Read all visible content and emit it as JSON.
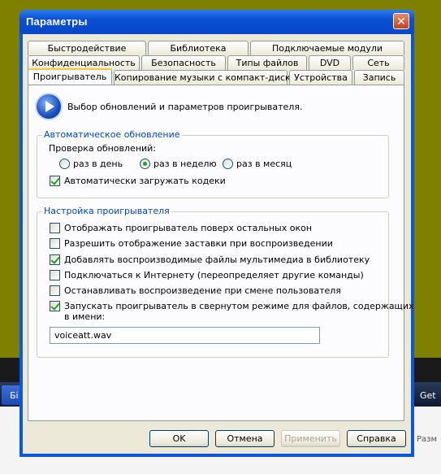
{
  "window": {
    "title": "Параметры"
  },
  "tabs": {
    "row1": [
      "Быстродействие",
      "Библиотека",
      "Подключаемые модули"
    ],
    "row2": [
      "Конфиденциальность",
      "Безопасность",
      "Типы файлов",
      "DVD",
      "Сеть"
    ],
    "row3": [
      "Проигрыватель",
      "Копирование музыки с компакт-диска",
      "Устройства",
      "Запись"
    ]
  },
  "panel": {
    "description": "Выбор обновлений и параметров проигрывателя.",
    "auto_update": {
      "legend": "Автоматическое обновление",
      "check_label": "Проверка обновлений:",
      "options": [
        "раз в день",
        "раз в неделю",
        "раз в месяц"
      ],
      "selected": "раз в неделю",
      "download_codecs": {
        "label": "Автоматически загружать кодеки",
        "checked": true
      }
    },
    "player_settings": {
      "legend": "Настройка проигрывателя",
      "options": [
        {
          "label": "Отображать проигрыватель поверх остальных окон",
          "checked": false
        },
        {
          "label": "Разрешить отображение заставки при воспроизведении",
          "checked": false
        },
        {
          "label": "Добавлять воспроизводимые файлы мультимедиа в библиотеку",
          "checked": true
        },
        {
          "label": "Подключаться к Интернету (переопределяет другие команды)",
          "checked": false
        },
        {
          "label": "Останавливать воспроизведение при смене пользователя",
          "checked": false
        },
        {
          "label": "Запускать проигрыватель в свернутом режиме для файлов, содержащих",
          "label2": "в имени:",
          "checked": true
        }
      ],
      "filename_value": "voiceatt.wav"
    }
  },
  "buttons": {
    "ok": "OK",
    "cancel": "Отмена",
    "apply": "Применить",
    "help": "Справка"
  },
  "background": {
    "left_button": "Бі",
    "right_button": "Get",
    "right_text": "Разм"
  },
  "colors": {
    "accent": "#0b56e0",
    "legend_text": "#0046d5",
    "desktop": "#808000"
  }
}
